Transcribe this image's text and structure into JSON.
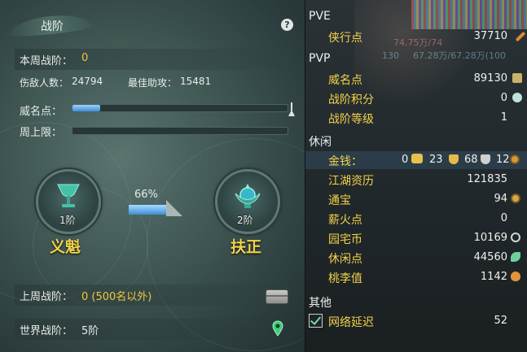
{
  "left": {
    "title": "战阶",
    "help": "?",
    "week_rank_label": "本周战阶：",
    "week_rank_value": "0",
    "kills_label": "伤敌人数：",
    "kills_value": "24794",
    "assist_label": "最佳助攻：",
    "assist_value": "15481",
    "prestige_label": "威名点：",
    "prestige_progress": 0.13,
    "weekly_cap_label": "周上限：",
    "weekly_cap_progress": 0.0,
    "current_rank": {
      "level": "1阶",
      "name": "义魁"
    },
    "next_rank": {
      "level": "2阶",
      "name": "扶正"
    },
    "advance_percent": "66%",
    "advance_progress": 0.66,
    "last_week_label": "上周战阶：",
    "last_week_value": "0 (500名以外)",
    "world_rank_label": "世界战阶：",
    "world_rank_value": "5阶"
  },
  "right": {
    "sections": {
      "pve": "PVE",
      "pvp": "PVP",
      "leisure": "休闲",
      "other": "其他"
    },
    "items": {
      "xiaxing": {
        "label": "侠行点",
        "value": "37710"
      },
      "weiming": {
        "label": "威名点",
        "value": "89130"
      },
      "zhanjie_score": {
        "label": "战阶积分",
        "value": "0"
      },
      "zhanjie_level": {
        "label": "战阶等级",
        "value": "1"
      },
      "money": {
        "label": "金钱：",
        "v1": "0",
        "v2": "23",
        "v3": "68",
        "v4": "12"
      },
      "jianghu": {
        "label": "江湖资历",
        "value": "121835"
      },
      "tongbao": {
        "label": "通宝",
        "value": "94"
      },
      "xinhuo": {
        "label": "薪火点",
        "value": "0"
      },
      "yuanzhai": {
        "label": "园宅币",
        "value": "10169"
      },
      "xiuxian": {
        "label": "休闲点",
        "value": "44560"
      },
      "taoli": {
        "label": "桃李值",
        "value": "1142"
      },
      "latency": {
        "label": "网络延迟",
        "value": "52"
      }
    },
    "faded_bg_texts": [
      "74.75万/74",
      "130",
      "67.28万/67.28万(100"
    ],
    "colors": {
      "accent_gold": "#f3d24a",
      "bar_blue": "#3b8fd7"
    }
  }
}
